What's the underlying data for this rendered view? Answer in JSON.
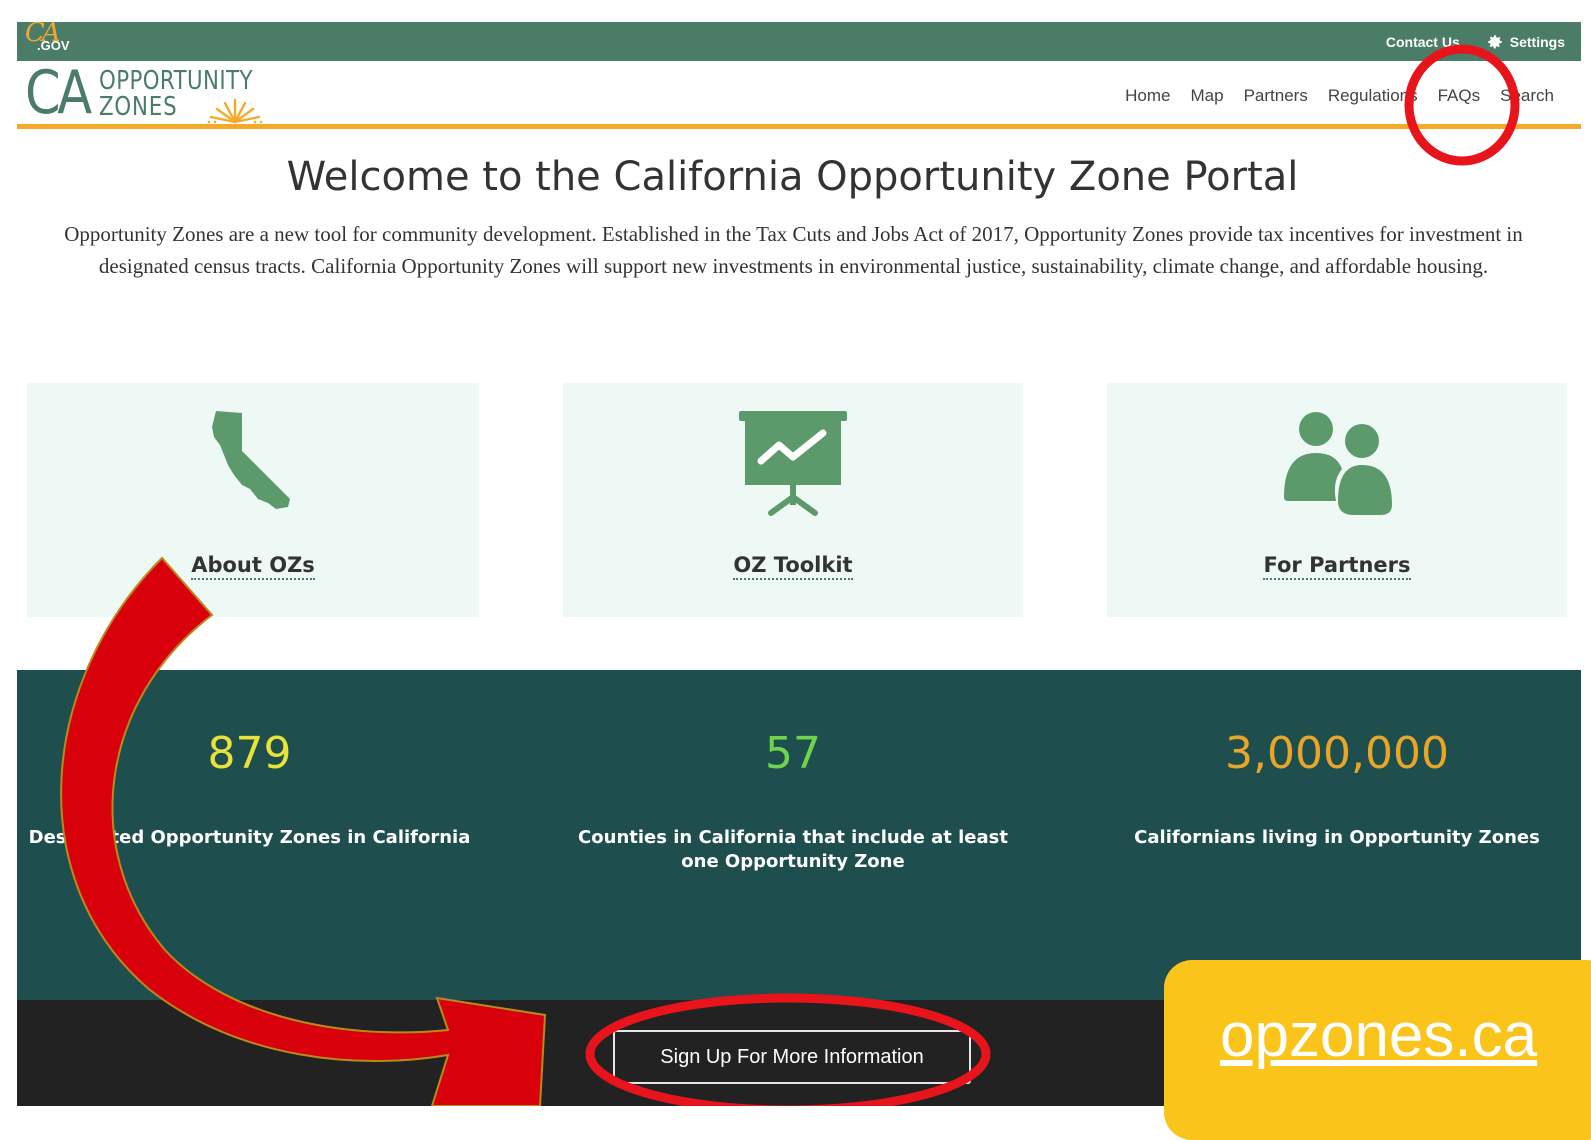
{
  "utility_bar": {
    "gov_logo": "CA.GOV",
    "contact_label": "Contact Us",
    "settings_label": "Settings"
  },
  "brand": {
    "line_ca": "CA",
    "line_top": "OPPORTUNITY",
    "line_bottom": "ZONES"
  },
  "nav": {
    "items": [
      "Home",
      "Map",
      "Partners",
      "Regulations",
      "FAQs",
      "Search"
    ]
  },
  "welcome": {
    "title": "Welcome to the California Opportunity Zone Portal",
    "text": "Opportunity Zones are a new tool for community development. Established in the Tax Cuts and Jobs Act of 2017, Opportunity Zones provide tax incentives for investment in designated census tracts. California Opportunity Zones will support new investments in environmental justice, sustainability, climate change, and affordable housing."
  },
  "cards": [
    {
      "label": "About OZs",
      "icon": "california-icon"
    },
    {
      "label": "OZ Toolkit",
      "icon": "presentation-chart-icon"
    },
    {
      "label": "For Partners",
      "icon": "people-icon"
    }
  ],
  "stats": [
    {
      "value": "879",
      "label": "Designated Opportunity Zones in California",
      "color": "#e8e23a"
    },
    {
      "value": "57",
      "label": "Counties in California that include at least one Opportunity Zone",
      "color": "#6fd44a"
    },
    {
      "value": "3,000,000",
      "label": "Californians living in Opportunity Zones",
      "color": "#e8a626"
    }
  ],
  "footer": {
    "signup_label": "Sign Up For More Information"
  },
  "callout": {
    "url_text": "opzones.ca"
  },
  "colors": {
    "header_green": "#4a7c68",
    "accent_orange": "#f5a928",
    "stats_bg": "#1f4e4e",
    "annotation_red": "#e8141b",
    "callout_yellow": "#fbc41a"
  }
}
